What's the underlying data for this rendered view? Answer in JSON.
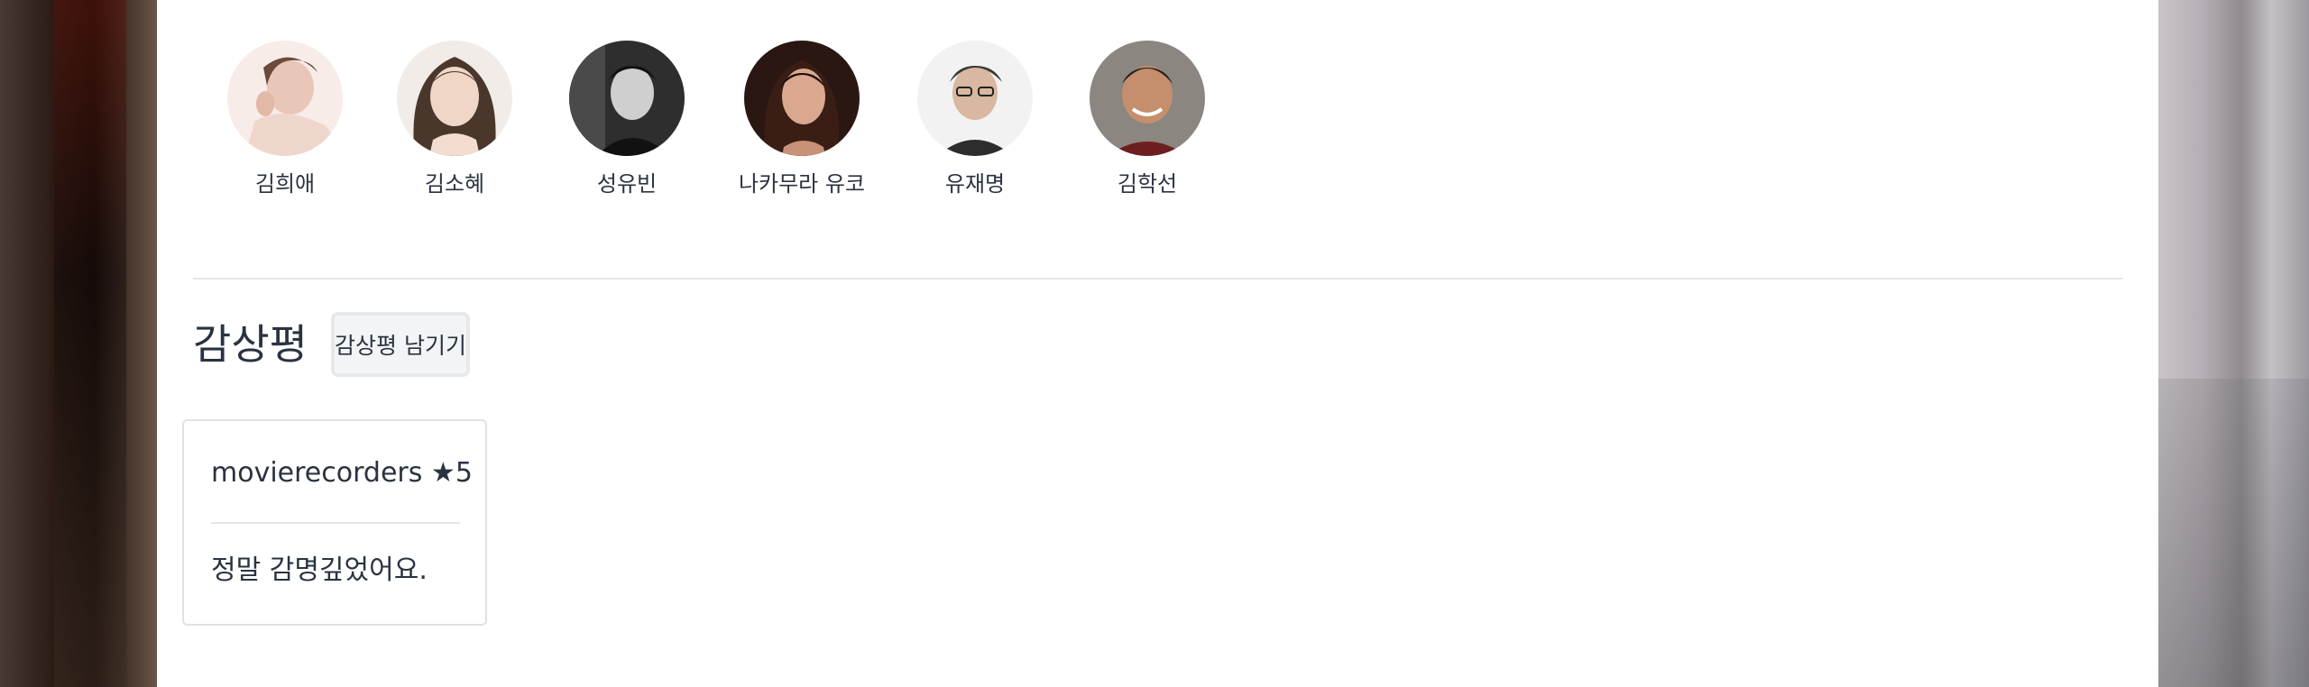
{
  "cast": [
    {
      "name": "김희애",
      "photo": "avatar-photo-1"
    },
    {
      "name": "김소혜",
      "photo": "avatar-photo-2"
    },
    {
      "name": "성유빈",
      "photo": "avatar-photo-3"
    },
    {
      "name": "나카무라 유코",
      "photo": "avatar-photo-4"
    },
    {
      "name": "유재명",
      "photo": "avatar-photo-5"
    },
    {
      "name": "김학선",
      "photo": "avatar-photo-6"
    }
  ],
  "reviews": {
    "title": "감상평",
    "write_button": "감상평 남기기",
    "items": [
      {
        "author": "movierecorders",
        "rating_label": "★5",
        "text": "정말 감명깊었어요."
      }
    ]
  },
  "colors": {
    "text": "#2a3340",
    "divider": "#e4e6e9",
    "button_bg": "#f3f4f5",
    "panel_bg": "#ffffff"
  }
}
